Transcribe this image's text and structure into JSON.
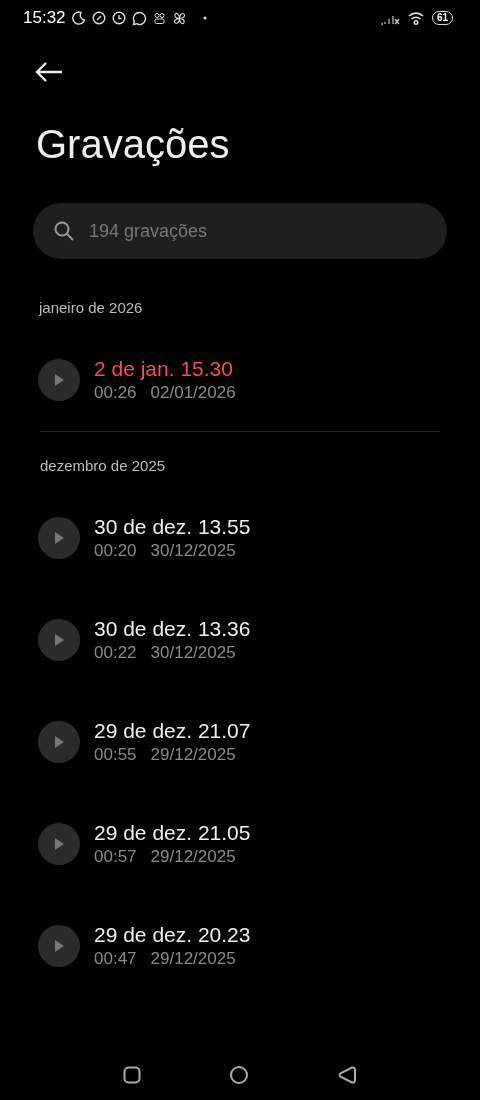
{
  "status_bar": {
    "time": "15:32",
    "battery": "61"
  },
  "title": "Gravações",
  "search": {
    "placeholder": "194 gravações"
  },
  "sections": [
    {
      "header": "janeiro de 2026",
      "items": [
        {
          "title": "2 de jan. 15.30",
          "duration": "00:26",
          "date": "02/01/2026",
          "selected": true
        }
      ]
    },
    {
      "header": "dezembro de 2025",
      "items": [
        {
          "title": "30 de dez. 13.55",
          "duration": "00:20",
          "date": "30/12/2025",
          "selected": false
        },
        {
          "title": "30 de dez. 13.36",
          "duration": "00:22",
          "date": "30/12/2025",
          "selected": false
        },
        {
          "title": "29 de dez. 21.07",
          "duration": "00:55",
          "date": "29/12/2025",
          "selected": false
        },
        {
          "title": "29 de dez. 21.05",
          "duration": "00:57",
          "date": "29/12/2025",
          "selected": false
        },
        {
          "title": "29 de dez. 20.23",
          "duration": "00:47",
          "date": "29/12/2025",
          "selected": false
        }
      ]
    }
  ]
}
